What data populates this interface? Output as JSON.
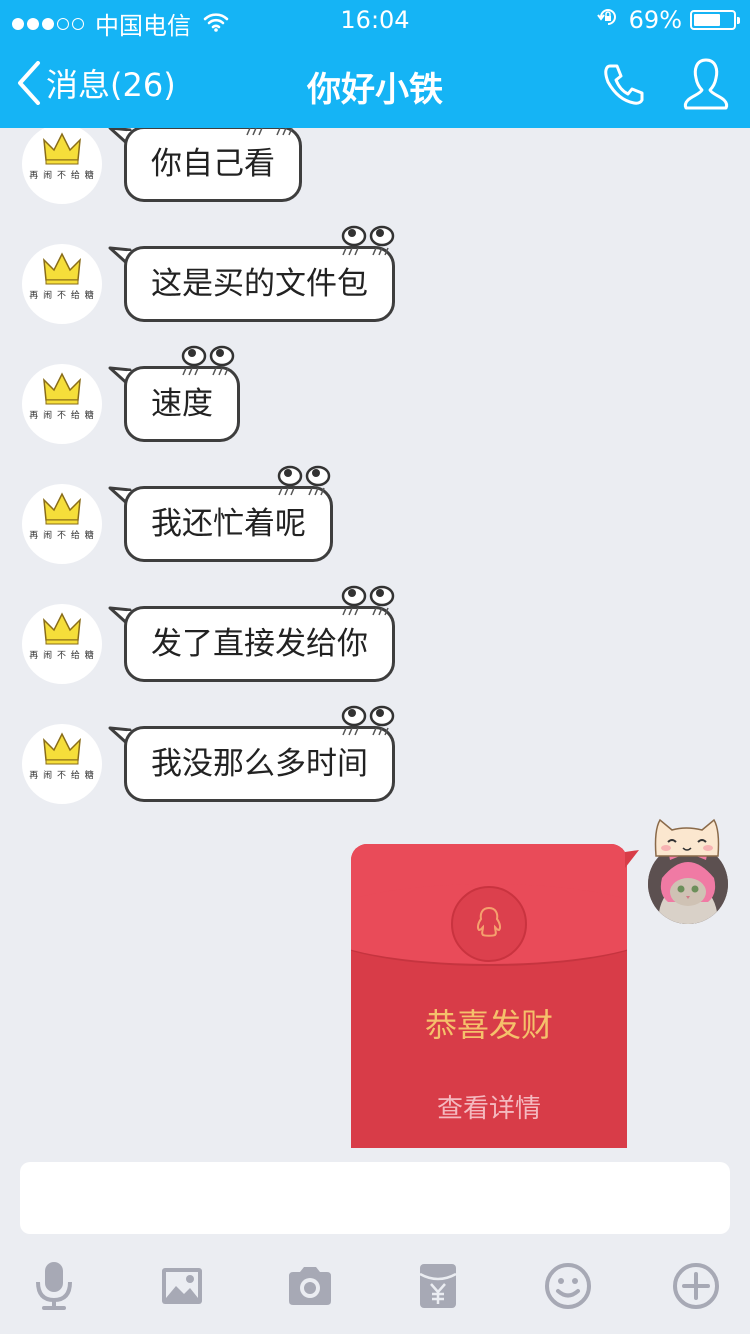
{
  "status_bar": {
    "carrier": "中国电信",
    "time": "16:04",
    "battery_percent": "69%",
    "battery_level": 0.69,
    "signal_bars": 3
  },
  "nav": {
    "back_label": "消息(26)",
    "title": "你好小铁",
    "icons": [
      "back-chevron-icon",
      "phone-icon",
      "profile-icon"
    ]
  },
  "messages": [
    {
      "sender": "other",
      "text": "你自己看"
    },
    {
      "sender": "other",
      "text": "这是买的文件包"
    },
    {
      "sender": "other",
      "text": "速度"
    },
    {
      "sender": "other",
      "text": "我还忙着呢"
    },
    {
      "sender": "other",
      "text": "发了直接发给你"
    },
    {
      "sender": "other",
      "text": "我没那么多时间"
    }
  ],
  "red_packet": {
    "title": "恭喜发财",
    "link": "查看详情",
    "icon": "penguin-icon"
  },
  "input": {
    "placeholder": ""
  },
  "toolbar": {
    "items": [
      "microphone-icon",
      "image-icon",
      "camera-icon",
      "red-packet-icon",
      "emoji-icon",
      "plus-icon"
    ]
  },
  "colors": {
    "nav_bg": "#15b4f5",
    "chat_bg": "#ebedf2",
    "red_packet": "#d83c48",
    "red_packet_title": "#f5c16b"
  }
}
